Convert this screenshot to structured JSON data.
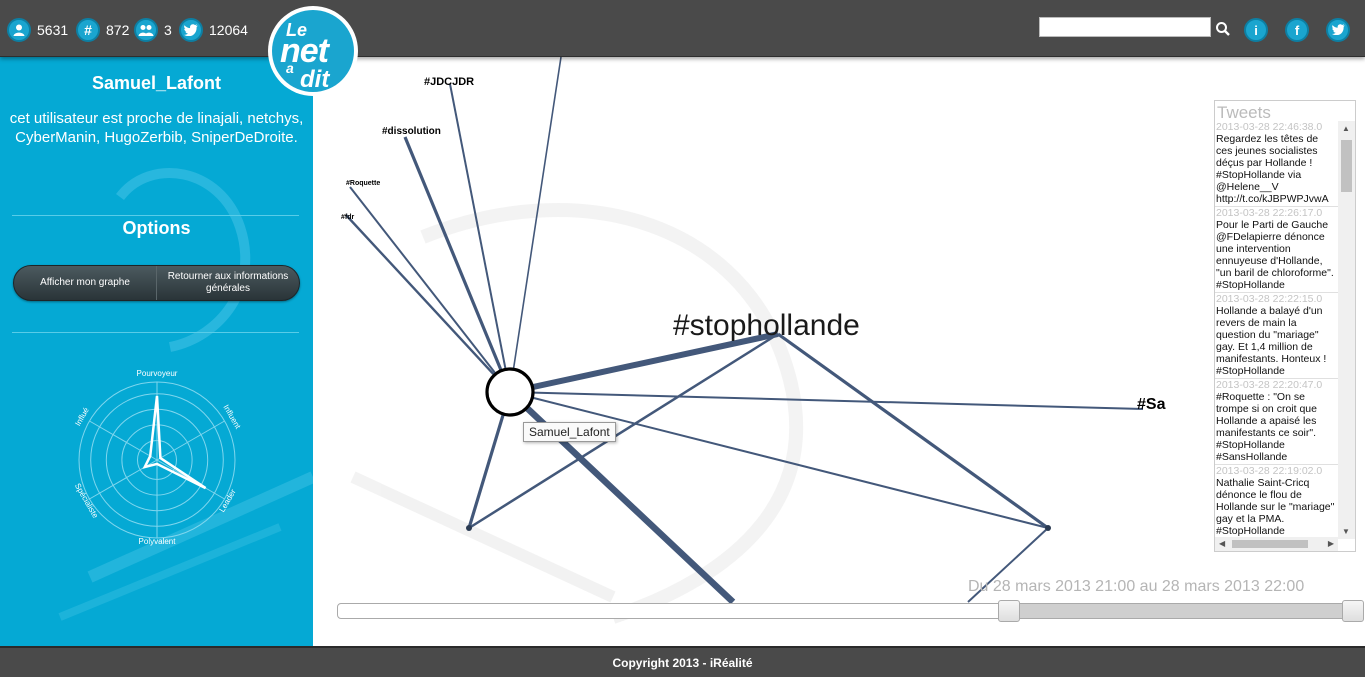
{
  "header": {
    "stats": [
      {
        "icon": "user-icon",
        "value": "5631"
      },
      {
        "icon": "hashtag-icon",
        "value": "872"
      },
      {
        "icon": "group-icon",
        "value": "3"
      },
      {
        "icon": "twitter-bird-icon",
        "value": "12064"
      }
    ],
    "logo": {
      "line1": "Le",
      "line2": "net",
      "line3": "a",
      "line4": "dit"
    },
    "search": {
      "value": "",
      "placeholder": ""
    },
    "buttons": [
      {
        "name": "info-button",
        "icon": "info-icon",
        "glyph": "i"
      },
      {
        "name": "facebook-button",
        "icon": "facebook-icon",
        "glyph": "f"
      },
      {
        "name": "twitter-button",
        "icon": "twitter-bird-icon",
        "glyph": "t"
      }
    ]
  },
  "sidebar": {
    "user_name": "Samuel_Lafont",
    "user_desc": "cet utilisateur est proche de linajali, netchys, CyberManin, HugoZerbib, SniperDeDroite.",
    "options_title": "Options",
    "options": {
      "show_graph": "Afficher mon graphe",
      "back": "Retourner aux informations générales"
    },
    "radar": {
      "axes": [
        "Pourvoyeur",
        "Influent",
        "Leader",
        "Polyvalent",
        "Spécialiste",
        "Influé"
      ],
      "values": [
        0.82,
        0.05,
        0.72,
        0.05,
        0.18,
        0.1
      ]
    }
  },
  "graph": {
    "nodes": [
      {
        "id": "samuel",
        "label": "",
        "kind": "user"
      },
      {
        "id": "stophollande",
        "label": "#stophollande",
        "size": "xl"
      },
      {
        "id": "jdcjdr",
        "label": "#JDCJDR",
        "size": "sm"
      },
      {
        "id": "dissolution",
        "label": "#dissolution",
        "size": "sm"
      },
      {
        "id": "roquette",
        "label": "#Roquette",
        "size": "xs"
      },
      {
        "id": "fdr",
        "label": "#fdr",
        "size": "xs"
      },
      {
        "id": "sa",
        "label": "#Sa",
        "size": "md"
      }
    ],
    "tooltip": "Samuel_Lafont"
  },
  "tweets": {
    "title": "Tweets",
    "items": [
      {
        "date": "2013-03-28 22:46:38.0",
        "text": "Regardez les têtes de ces jeunes socialistes déçus par Hollande ! #StopHollande via @Helene__V http://t.co/kJBPWPJvwA"
      },
      {
        "date": "2013-03-28 22:26:17.0",
        "text": "Pour le Parti de Gauche @FDelapierre dénonce une intervention ennuyeuse d'Hollande, \"un baril de chloroforme\". #StopHollande"
      },
      {
        "date": "2013-03-28 22:22:15.0",
        "text": "Hollande a balayé d'un revers de main la question du \"mariage\" gay. Et 1,4 million de manifestants. Honteux ! #StopHollande"
      },
      {
        "date": "2013-03-28 22:20:47.0",
        "text": "#Roquette : \"On se trompe si on croit que Hollande a apaisé les manifestants ce soir\". #StopHollande #SansHollande"
      },
      {
        "date": "2013-03-28 22:19:02.0",
        "text": "Nathalie Saint-Cricq dénonce le flou de Hollande sur le \"mariage\" gay et la PMA. #StopHollande #SansHollande"
      }
    ]
  },
  "timeline": {
    "range_text": "Du 28 mars 2013 21:00 au 28 mars 2013 22:00",
    "selected_start_fraction": 0.66,
    "selected_end_fraction": 1.0
  },
  "footer": {
    "text": "Copyright 2013 - iRéalité"
  },
  "colors": {
    "accent": "#05a9d4",
    "bar": "#4a4a4a",
    "edge": "#43587a"
  }
}
